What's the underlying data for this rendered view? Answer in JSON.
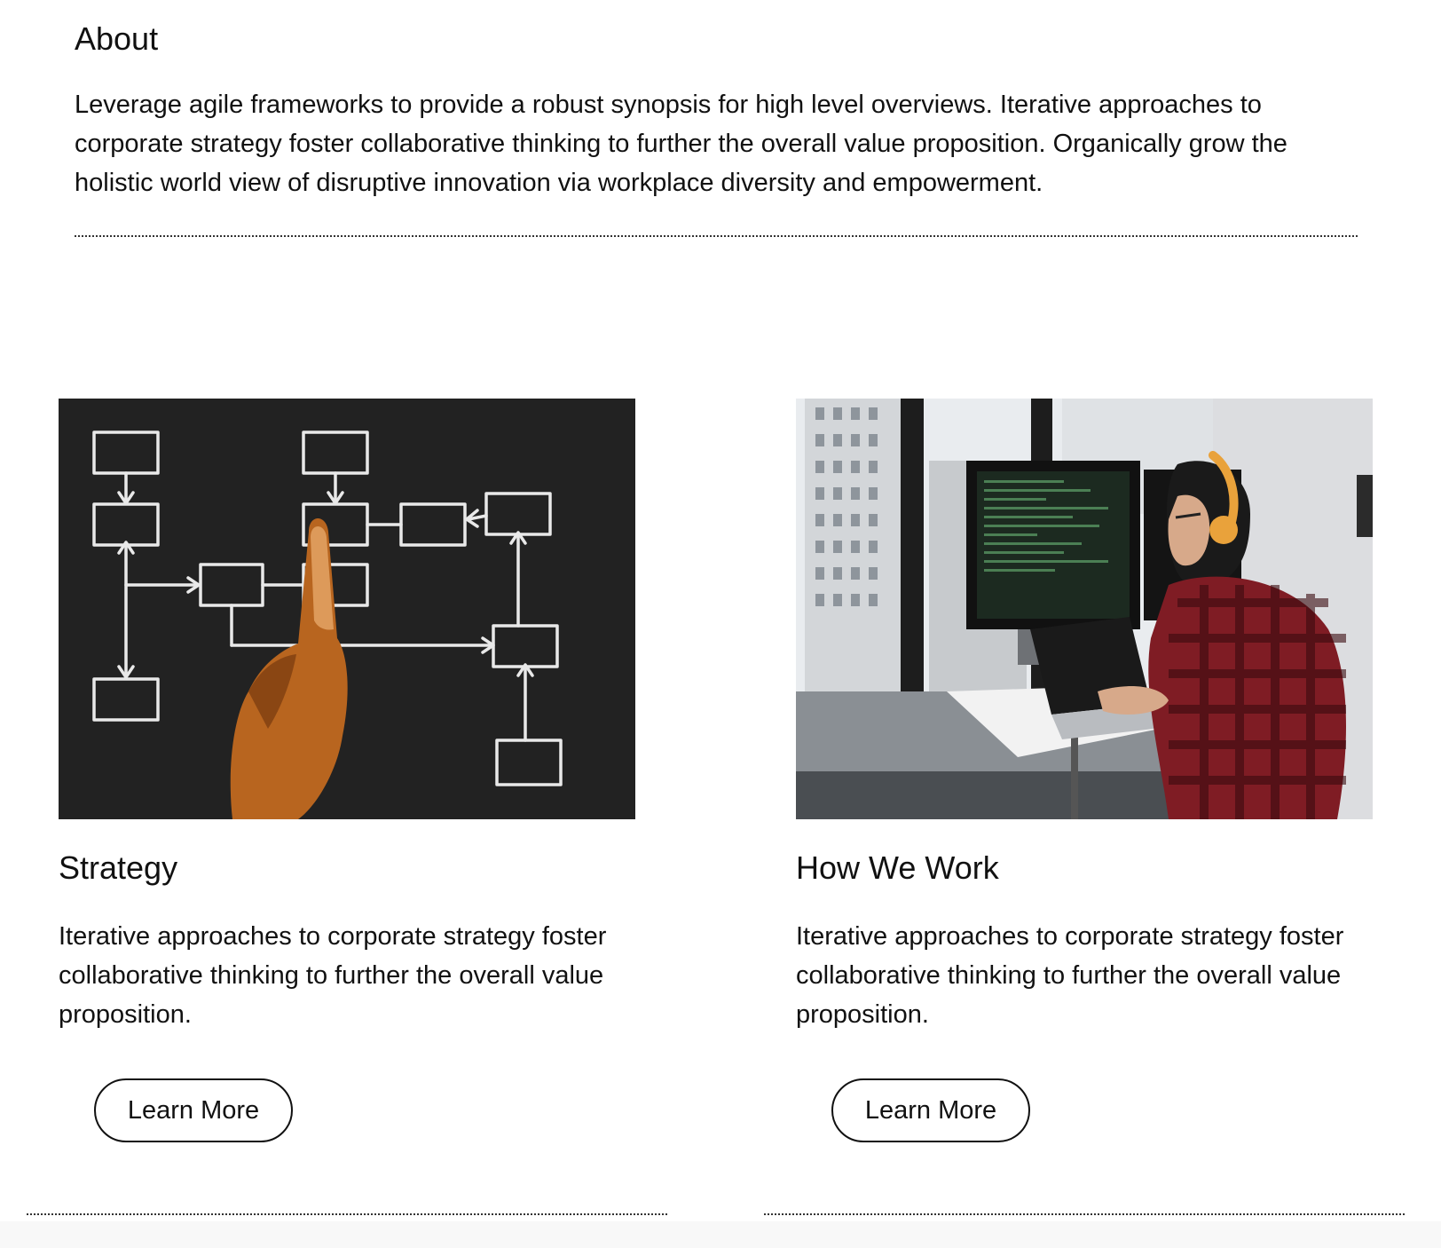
{
  "about": {
    "title": "About",
    "body": "Leverage agile frameworks to provide a robust synopsis for high level overviews. Iterative approaches to corporate strategy foster collaborative thinking to further the overall value proposition. Organically grow the holistic world view of disruptive innovation via workplace diversity and empowerment."
  },
  "cards": [
    {
      "image": "flowchart-diagram-photo",
      "title": "Strategy",
      "body": "Iterative approaches to corporate strategy foster collaborative thinking to further the overall value proposition.",
      "button": "Learn More"
    },
    {
      "image": "developer-workstation-photo",
      "title": "How We Work",
      "body": "Iterative approaches to corporate strategy foster collaborative thinking to further the overall value proposition.",
      "button": "Learn More"
    }
  ]
}
